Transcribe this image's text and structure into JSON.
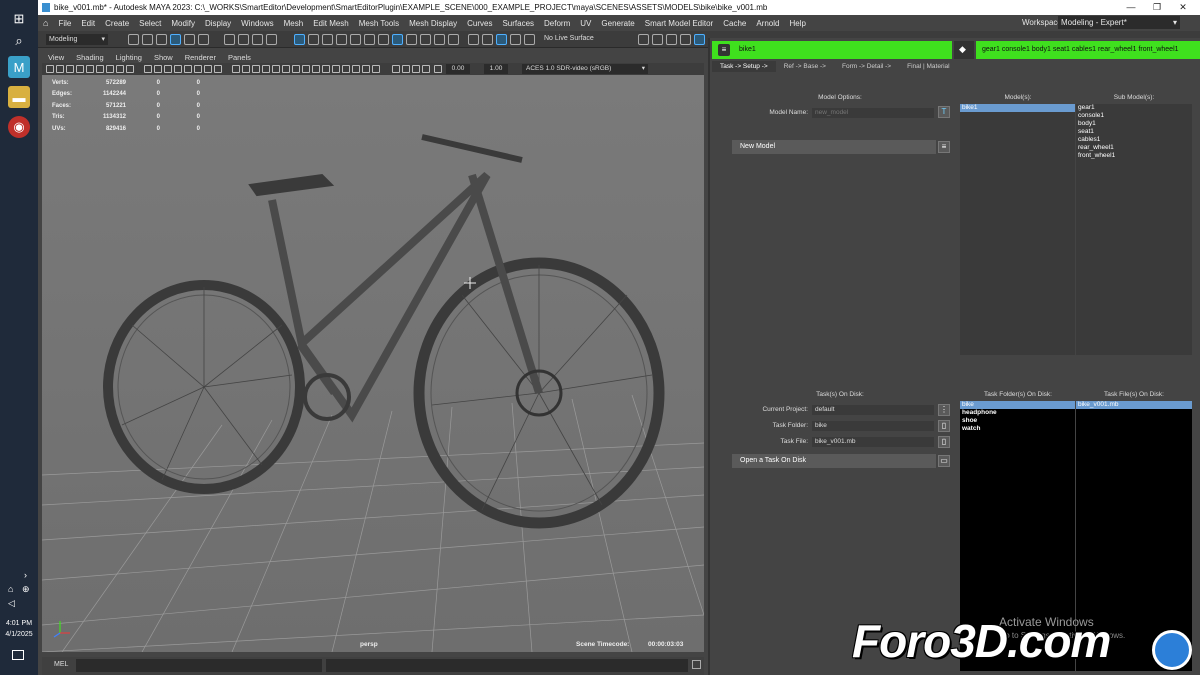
{
  "window": {
    "title": "bike_v001.mb* - Autodesk MAYA 2023: C:\\_WORKS\\SmartEditor\\Development\\SmartEditorPlugin\\EXAMPLE_SCENE\\000_EXAMPLE_PROJECT\\maya\\SCENES\\ASSETS\\MODELS\\bike\\bike_v001.mb",
    "minimize": "—",
    "maximize": "❐",
    "close": "✕"
  },
  "menubar": {
    "items": [
      "File",
      "Edit",
      "Create",
      "Select",
      "Modify",
      "Display",
      "Windows",
      "Mesh",
      "Edit Mesh",
      "Mesh Tools",
      "Mesh Display",
      "Curves",
      "Surfaces",
      "Deform",
      "UV",
      "Generate",
      "Smart Model Editor",
      "Cache",
      "Arnold",
      "Help"
    ],
    "workspace_label": "Workspace:",
    "workspace_value": "Modeling - Expert*"
  },
  "shelf": {
    "mode": "Modeling",
    "live_surface": "No Live Surface"
  },
  "viewport": {
    "menu": [
      "View",
      "Shading",
      "Lighting",
      "Show",
      "Renderer",
      "Panels"
    ],
    "exposure": "0.00",
    "gamma": "1.00",
    "colorspace": "ACES 1.0 SDR-video (sRGB)",
    "camera": "persp",
    "timecode_label": "Scene Timecode:",
    "timecode": "00:00:03:03",
    "hud": [
      [
        "Verts:",
        "572289",
        "0",
        "0"
      ],
      [
        "Edges:",
        "1142244",
        "0",
        "0"
      ],
      [
        "Faces:",
        "571221",
        "0",
        "0"
      ],
      [
        "Tris:",
        "1134312",
        "0",
        "0"
      ],
      [
        "UVs:",
        "829416",
        "0",
        "0"
      ]
    ]
  },
  "plugin": {
    "model_tab": "bike1",
    "submodels_line": "gear1 console1 body1 seat1 cables1 rear_wheel1 front_wheel1",
    "tabs": [
      "Task -> Setup ->",
      "Ref -> Base ->",
      "Form -> Detail ->",
      "Final | Material"
    ],
    "model_options": "Model Options:",
    "model_name_label": "Model Name:",
    "model_name_placeholder": "new_model",
    "new_model": "New Model",
    "models_header": "Model(s):",
    "models": [
      "bike1"
    ],
    "submodels_header": "Sub Model(s):",
    "submodels": [
      "gear1",
      "console1",
      "body1",
      "seat1",
      "cables1",
      "rear_wheel1",
      "front_wheel1"
    ],
    "tasks_on_disk": "Task(s) On Disk:",
    "current_project_label": "Current Project:",
    "current_project": "default",
    "task_folder_label": "Task Folder:",
    "task_folder": "bike",
    "task_file_label": "Task File:",
    "task_file": "bike_v001.mb",
    "open_task": "Open a Task On Disk",
    "folders_header": "Task Folder(s) On Disk:",
    "folders": [
      "bike",
      "headphone",
      "shoe",
      "watch"
    ],
    "files_header": "Task File(s) On Disk:",
    "files": [
      "bike_v001.mb"
    ]
  },
  "taskbar": {
    "time": "4:01 PM",
    "date": "4/1/2025"
  },
  "cmd": {
    "label": "MEL"
  },
  "overlay": {
    "activate": "Activate Windows",
    "settings": "Go to Settings to activate Windows.",
    "watermark": "Foro3D.com"
  },
  "colors": {
    "accent_green": "#3fe01e",
    "selection": "#6a9bd0"
  }
}
